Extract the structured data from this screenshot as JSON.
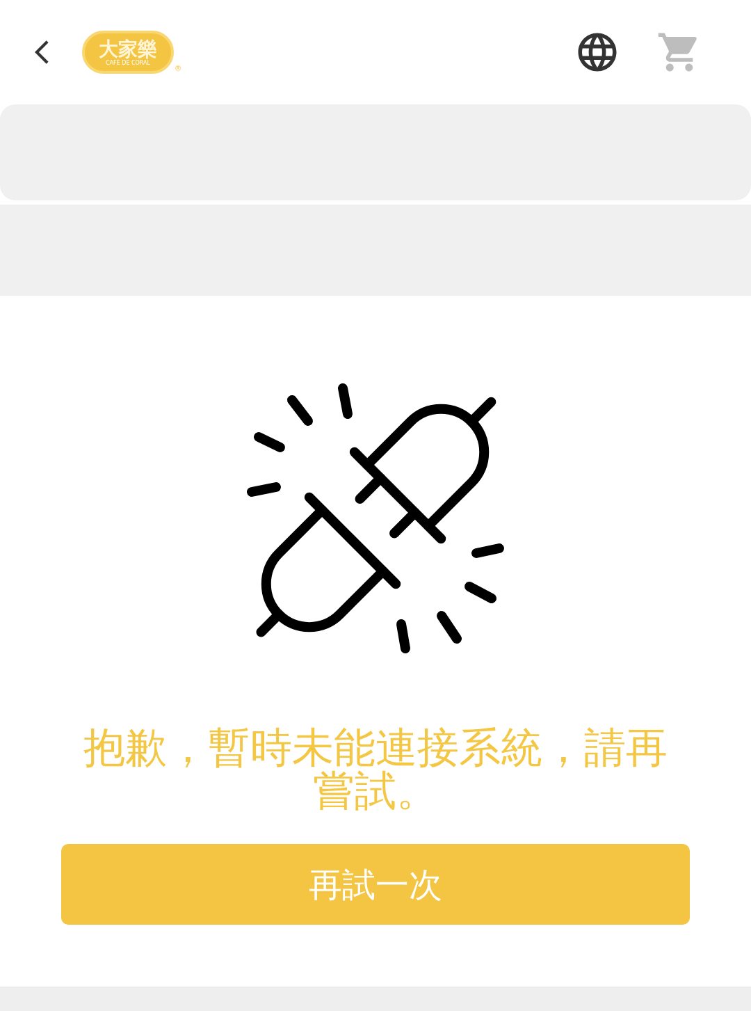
{
  "header": {
    "logo": {
      "name": "大家樂",
      "subtitle": "CAFE DE CORAL",
      "mark": "®"
    },
    "cart": {
      "disabled": true
    }
  },
  "error": {
    "message": "抱歉，暫時未能連接系統，請再嘗試。",
    "retry_button": "再試一次"
  }
}
